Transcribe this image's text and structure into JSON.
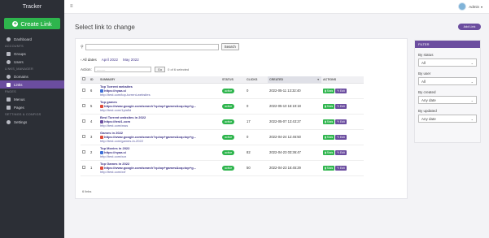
{
  "sidebar": {
    "brand": "Tracker",
    "create_label": "Create Link",
    "sections": [
      {
        "id": "dashboard",
        "type": "item",
        "label": "Dashboard",
        "icon": "dashboard-icon"
      },
      {
        "id": "accounts",
        "type": "section",
        "label": "ACCOUNTS"
      },
      {
        "id": "groups",
        "type": "item",
        "label": "Groups",
        "icon": "groups-icon"
      },
      {
        "id": "users",
        "type": "item",
        "label": "Users",
        "icon": "users-icon"
      },
      {
        "id": "links_manager",
        "type": "section",
        "label": "LINKS_MANAGER"
      },
      {
        "id": "domains",
        "type": "item",
        "label": "Domains",
        "icon": "globe-icon"
      },
      {
        "id": "links",
        "type": "item",
        "label": "Links",
        "icon": "link-icon",
        "active": true
      },
      {
        "id": "pages",
        "type": "section",
        "label": "PAGES"
      },
      {
        "id": "menus",
        "type": "item",
        "label": "Menus",
        "icon": "menu-icon"
      },
      {
        "id": "pages_item",
        "type": "item",
        "label": "Pages",
        "icon": "page-icon"
      },
      {
        "id": "settings_config",
        "type": "section",
        "label": "SETTINGS & CONFIGS"
      },
      {
        "id": "settings",
        "type": "item",
        "label": "Settings",
        "icon": "gear-icon"
      }
    ]
  },
  "topbar": {
    "user_name": "Admin",
    "hamburger_icon": "≡"
  },
  "page": {
    "title": "Select link to change",
    "add_button": "Add Link"
  },
  "search": {
    "placeholder": "",
    "button": "Search"
  },
  "dates": {
    "all": "‹ All dates",
    "month1": "April 2022",
    "month2": "May 2022"
  },
  "action": {
    "label": "Action:",
    "select_value": "---------",
    "go": "Go",
    "selected": "0 of 6 selected"
  },
  "table": {
    "headers": {
      "id": "ID",
      "summary": "SUMMARY",
      "status": "STATUS",
      "clicks": "CLICKS",
      "created": "CREATED",
      "actions": "ACTIONS"
    },
    "stats_label": "Stats",
    "edit_label": "Edit",
    "rows": [
      {
        "id": "6",
        "title": "Top Torrent websites",
        "url": "https://nyaa.si",
        "short": "http://test.com/top-torrent-websites",
        "favicon": "#3b6fd8",
        "status": "active",
        "clicks": "0",
        "created": "2022-05-11 13:32:40"
      },
      {
        "id": "5",
        "title": "Top games",
        "url": "https://www.google.com/search?q=top+games&oq=top+g...",
        "short": "http://test.com/1yta5d",
        "favicon": "#e04a3a",
        "status": "active",
        "clicks": "0",
        "created": "2022-05-10 16:19:18"
      },
      {
        "id": "4",
        "title": "Best Torrent websites in 2022",
        "url": "https://test1.com",
        "short": "http://test.com/xsss",
        "favicon": "#6b4d9f",
        "status": "active",
        "clicks": "17",
        "created": "2022-05-07 13:43:27"
      },
      {
        "id": "3",
        "title": "Games in 2022",
        "url": "https://www.google.com/search?q=top+games&oq=top+g...",
        "short": "http://test.com/games-in-2022",
        "favicon": "#e04a3a",
        "status": "active",
        "clicks": "0",
        "created": "2022-04-24 12:46:50"
      },
      {
        "id": "2",
        "title": "Top Movies in 2022",
        "url": "https://nyaa.si",
        "short": "http://test.com/xzz",
        "favicon": "#3b6fd8",
        "status": "active",
        "clicks": "82",
        "created": "2022-04-23 03:36:47"
      },
      {
        "id": "1",
        "title": "Top Games in 2022",
        "url": "https://www.google.com/search?q=top+games&oq=top+g...",
        "short": "http://test.com/xxf",
        "favicon": "#e04a3a",
        "status": "active",
        "clicks": "50",
        "created": "2022-04-23 16:45:29"
      }
    ],
    "total": "6 links"
  },
  "filter": {
    "heading": "FILTER",
    "groups": [
      {
        "label": "By status",
        "value": "All"
      },
      {
        "label": "By user",
        "value": "All"
      },
      {
        "label": "By created",
        "value": "Any date"
      },
      {
        "label": "By updated",
        "value": "Any date"
      }
    ]
  },
  "colors": {
    "accent": "#6b4d9f",
    "success": "#2eb54d",
    "sidebar": "#2c2f36"
  }
}
